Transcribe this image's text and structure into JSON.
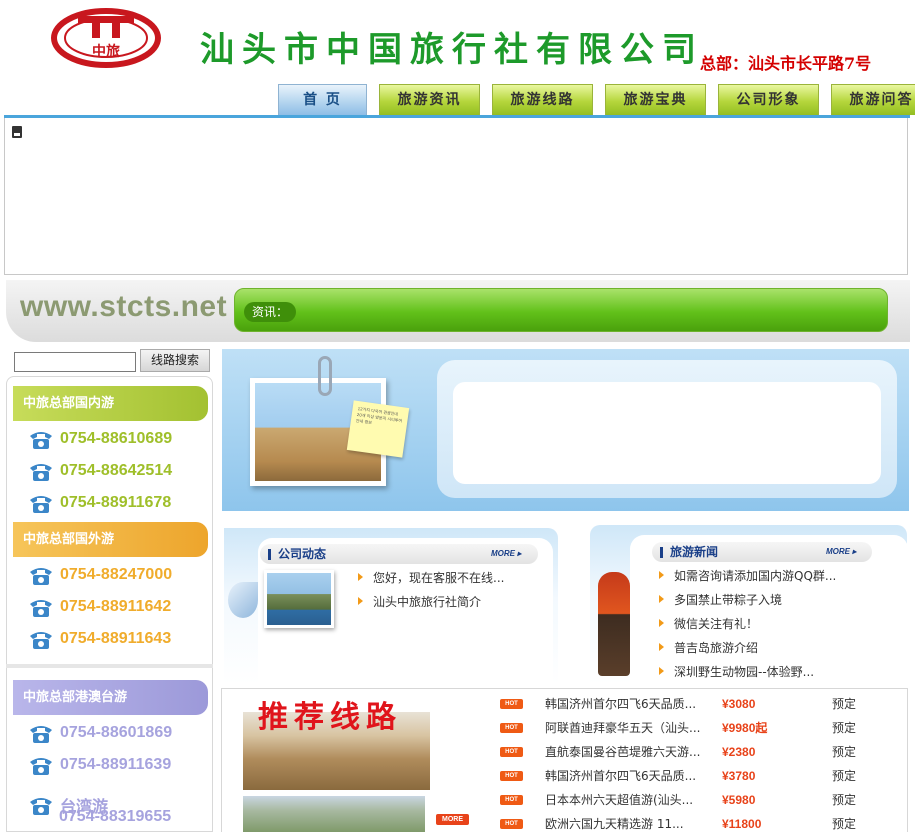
{
  "header": {
    "logo_text": "中旅",
    "company_name": "汕头市中国旅行社有限公司",
    "hq_address": "总部：汕头市长平路7号"
  },
  "nav": {
    "tabs": [
      {
        "label": "首 页"
      },
      {
        "label": "旅游资讯"
      },
      {
        "label": "旅游线路"
      },
      {
        "label": "旅游宝典"
      },
      {
        "label": "公司形象"
      },
      {
        "label": "旅游问答"
      }
    ]
  },
  "site_url": "www.stcts.net",
  "notice": {
    "label": "资讯："
  },
  "search": {
    "button_label": "线路搜索",
    "value": ""
  },
  "sidebar": {
    "domestic": {
      "title": "中旅总部国内游",
      "color": "#b3cc3c",
      "text_color": "#9fbf2a",
      "phones": [
        "0754-88610689",
        "0754-88642514",
        "0754-88911678"
      ]
    },
    "outbound": {
      "title": "中旅总部国外游",
      "color": "#f2b33c",
      "text_color": "#f0ac2c",
      "phones": [
        "0754-88247000",
        "0754-88911642",
        "0754-88911643"
      ]
    },
    "hk_macau_taiwan": {
      "title": "中旅总部港澳台游",
      "color": "#a7a4e0",
      "text_color": "#a6a3de",
      "phones": [
        "0754-88601869",
        "0754-88911639"
      ],
      "taiwan_label": "台湾游",
      "taiwan_phone": "0754-88319655"
    }
  },
  "ad": {
    "note_text": "12가지 다국어 관광안내 20개 이상 방문지 시티투어 안내 정보"
  },
  "company_news": {
    "title": "公司动态",
    "more": "MORE",
    "items": [
      "您好，现在客服不在线...",
      "汕头中旅旅行社简介"
    ]
  },
  "travel_news": {
    "title": "旅游新闻",
    "more": "MORE",
    "items": [
      "如需咨询请添加国内游QQ群...",
      "多国禁止带粽子入境",
      "微信关注有礼！",
      "普吉岛旅游介绍",
      "深圳野生动物园--体验野..."
    ]
  },
  "routes": {
    "title": "推荐线路",
    "more_label": "MORE",
    "hot_label": "HOT",
    "items": [
      {
        "name": "韩国济州首尔四飞6天品质...",
        "price": "¥3080",
        "action": "预定"
      },
      {
        "name": "阿联酋迪拜豪华五天（汕头...",
        "price": "¥9980起",
        "action": "预定"
      },
      {
        "name": "直航泰国曼谷芭堤雅六天游...",
        "price": "¥2380",
        "action": "预定"
      },
      {
        "name": "韩国济州首尔四飞6天品质...",
        "price": "¥3780",
        "action": "预定"
      },
      {
        "name": "日本本州六天超值游(汕头...",
        "price": "¥5980",
        "action": "预定"
      },
      {
        "name": "欧洲六国九天精选游 11...",
        "price": "¥11800",
        "action": "预定"
      }
    ]
  },
  "colors": {
    "brand_green": "#1d9a2a",
    "address_red": "#d40000",
    "nav_green": "#b5d63c",
    "price_orange": "#e8431a"
  }
}
